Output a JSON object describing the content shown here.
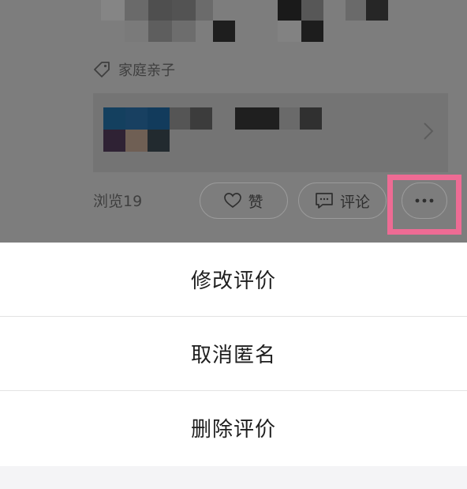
{
  "post": {
    "tag_label": "家庭亲子",
    "views_label": "浏览19",
    "like_label": "赞",
    "comment_label": "评论"
  },
  "icons": {
    "tag": "tag-icon",
    "heart": "heart-icon",
    "comment": "comment-icon",
    "more": "more-icon",
    "chevron": "chevron-right-icon"
  },
  "colors": {
    "highlight": "#ee6b94",
    "overlay": "#7d7d7d"
  },
  "action_sheet": {
    "items": [
      {
        "label": "修改评价"
      },
      {
        "label": "取消匿名"
      },
      {
        "label": "删除评价"
      }
    ]
  }
}
